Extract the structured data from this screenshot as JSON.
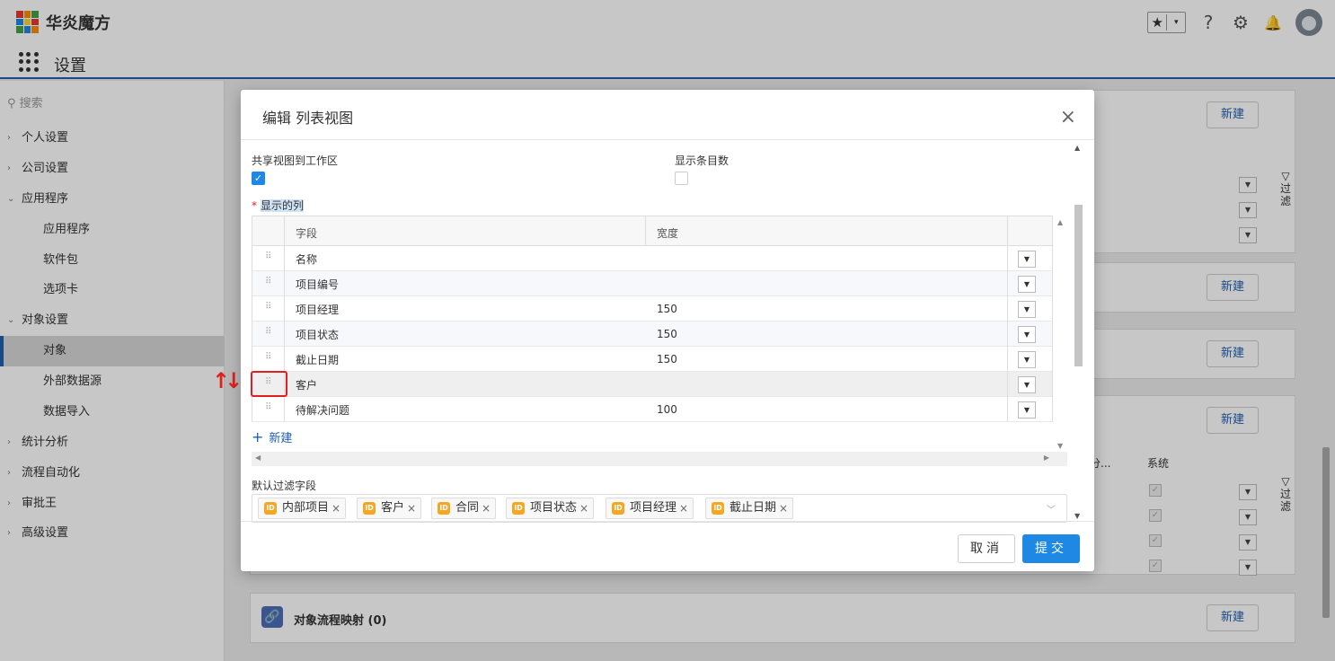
{
  "header": {
    "app_name": "华炎魔方",
    "page_title": "设置",
    "fav_star": "★",
    "fav_dd": "▾",
    "help": "?",
    "settings": "⚙",
    "bell": "🔔"
  },
  "sidebar": {
    "search_placeholder": "搜索",
    "items": [
      {
        "label": "个人设置",
        "chev": "›"
      },
      {
        "label": "公司设置",
        "chev": "›"
      },
      {
        "label": "应用程序",
        "chev": "⌄"
      },
      {
        "label": "应用程序"
      },
      {
        "label": "软件包"
      },
      {
        "label": "选项卡"
      },
      {
        "label": "对象设置",
        "chev": "⌄"
      },
      {
        "label": "对象"
      },
      {
        "label": "外部数据源"
      },
      {
        "label": "数据导入"
      },
      {
        "label": "统计分析",
        "chev": "›"
      },
      {
        "label": "流程自动化",
        "chev": "›"
      },
      {
        "label": "审批王",
        "chev": "›"
      },
      {
        "label": "高级设置",
        "chev": "›"
      }
    ]
  },
  "background": {
    "new_label": "新建",
    "filter_label": "▽ 过 滤",
    "col_fen": "分...",
    "col_system": "系统",
    "mapping_title": "对象流程映射 (0)",
    "link_icon": "🔗"
  },
  "modal": {
    "title": "编辑 列表视图",
    "close": "×",
    "share_label": "共享视图到工作区",
    "share_checked": "✓",
    "show_count_label": "显示条目数",
    "columns_label": "显示的列",
    "required": "*",
    "header_field": "字段",
    "header_width": "宽度",
    "rows": [
      {
        "field": "名称",
        "width": ""
      },
      {
        "field": "项目编号",
        "width": ""
      },
      {
        "field": "项目经理",
        "width": "150"
      },
      {
        "field": "项目状态",
        "width": "150"
      },
      {
        "field": "截止日期",
        "width": "150"
      },
      {
        "field": "客户",
        "width": ""
      },
      {
        "field": "待解决问题",
        "width": "100"
      }
    ],
    "grip": "⠿",
    "dd": "▼",
    "add_new": "新建",
    "add_plus": "+",
    "filter_label": "默认过滤字段",
    "filter_tags": [
      "内部项目",
      "客户",
      "合同",
      "项目状态",
      "项目经理",
      "截止日期"
    ],
    "tag_icon": "ID",
    "tag_x": "×",
    "cancel": "取消",
    "submit": "提交"
  },
  "drag_arrows": "↑↓"
}
